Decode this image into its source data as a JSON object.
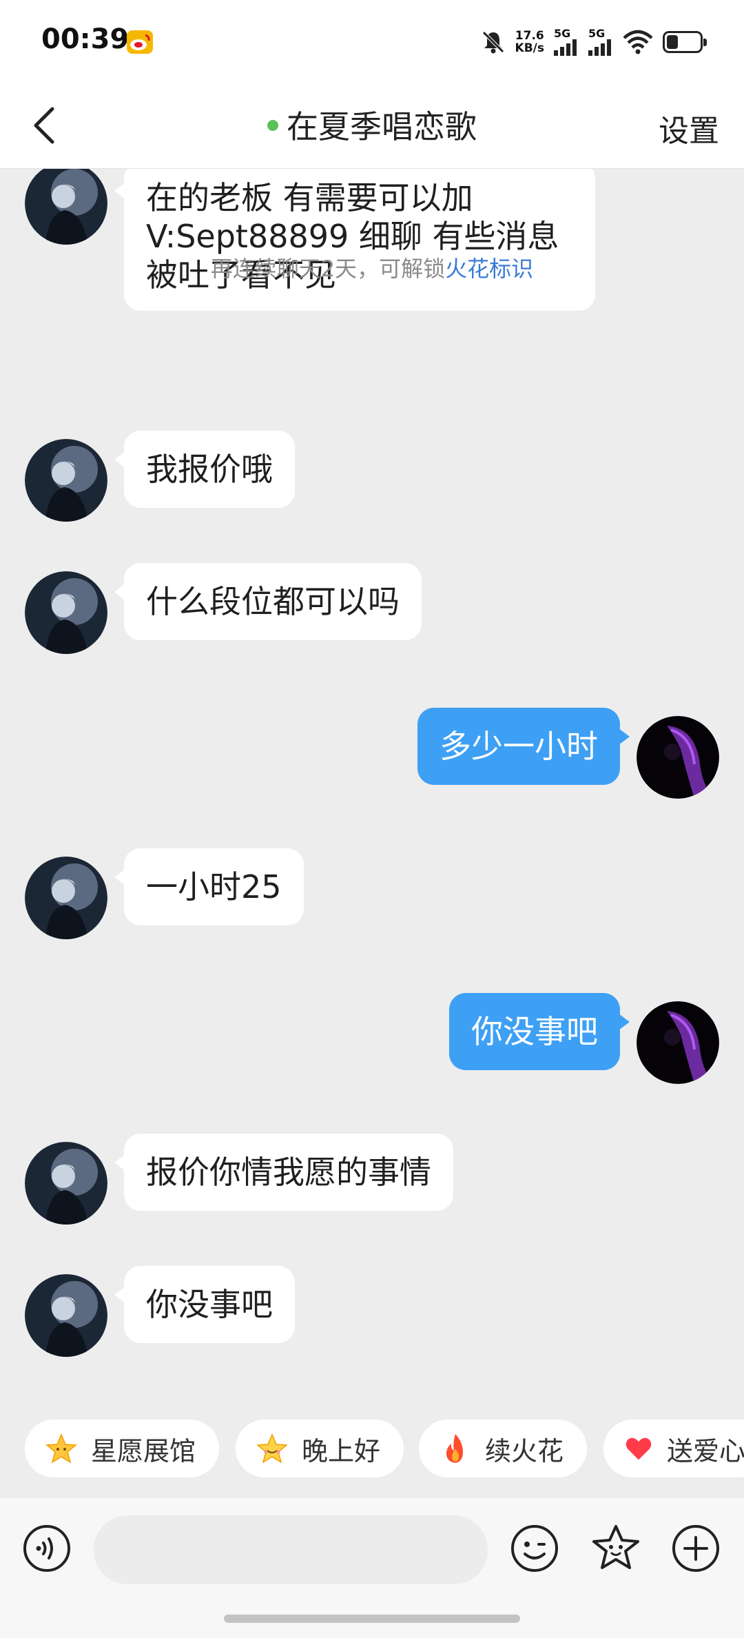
{
  "status_bar": {
    "time": "00:39",
    "net_speed_value": "17.6",
    "net_speed_unit": "KB/s",
    "signal1_label": "5G",
    "signal2_label": "5G",
    "icons": [
      "weibo-icon",
      "mute-bell-icon",
      "signal-icon",
      "signal-icon",
      "wifi-icon",
      "battery-icon"
    ]
  },
  "header": {
    "title": "在夏季唱恋歌",
    "settings_label": "设置",
    "online_color": "#5ac05a"
  },
  "system_note": {
    "text": "再连续聊天2天，可解锁",
    "link": "火花标识"
  },
  "messages": [
    {
      "from": "them",
      "text": " 在的老板  有需要可以加V:Sept88899  细聊 有些消息被吐了看不见"
    },
    {
      "from": "them",
      "text": "我报价哦"
    },
    {
      "from": "them",
      "text": "什么段位都可以吗"
    },
    {
      "from": "me",
      "text": "多少一小时"
    },
    {
      "from": "them",
      "text": "一小时25"
    },
    {
      "from": "me",
      "text": "你没事吧"
    },
    {
      "from": "them",
      "text": "报价你情我愿的事情"
    },
    {
      "from": "them",
      "text": "你没事吧"
    }
  ],
  "quick_chips": [
    {
      "icon": "star-icon",
      "label": "星愿展馆"
    },
    {
      "icon": "smiling-star-icon",
      "label": "晚上好"
    },
    {
      "icon": "fire-icon",
      "label": "续火花"
    },
    {
      "icon": "heart-icon",
      "label": "送爱心"
    }
  ],
  "input_bar": {
    "placeholder": "",
    "icons": [
      "voice-icon",
      "emoji-icon",
      "sticker-icon",
      "plus-icon"
    ]
  },
  "colors": {
    "outgoing_bubble": "#3ea0f5",
    "incoming_bubble": "#ffffff",
    "chat_background": "#ededed",
    "link": "#3a7bd5"
  }
}
